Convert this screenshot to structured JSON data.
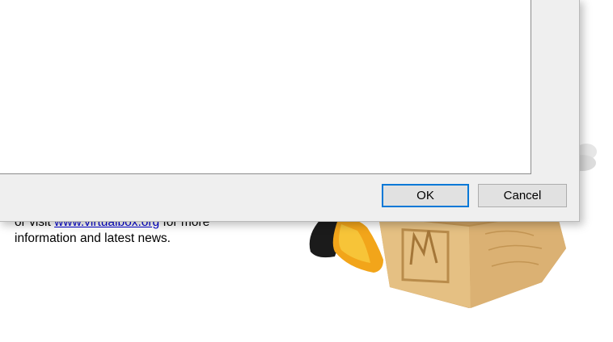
{
  "background": {
    "line1_prefix": "or visit ",
    "link_text": "www.virtualbox.org",
    "line1_suffix": " for more",
    "line2": "information and latest news."
  },
  "dialog": {
    "ok_label": "OK",
    "cancel_label": "Cancel"
  },
  "icons": {
    "mascot": "virtualbox-penguin-crate-illustration"
  },
  "colors": {
    "dialog_bg": "#efefef",
    "button_bg": "#e1e1e1",
    "default_button_border": "#0078d7",
    "link": "#0000cc"
  }
}
